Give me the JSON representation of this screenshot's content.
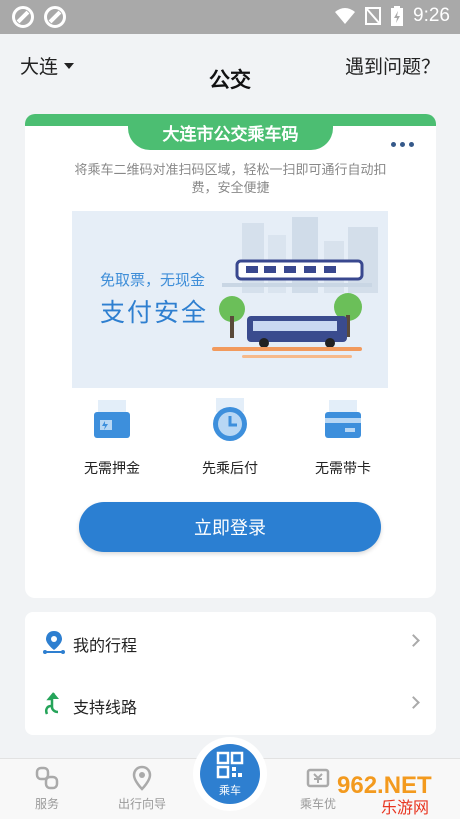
{
  "status_bar": {
    "time": "9:26"
  },
  "header": {
    "city": "大连",
    "title": "公交",
    "help": "遇到问题？"
  },
  "card": {
    "tab_title": "大连市公交乘车码",
    "description": "将乘车二维码对准扫码区域，轻松一扫即可通行自动扣费，安全便捷",
    "banner": {
      "subtitle": "免取票，无现金",
      "headline": "支付安全"
    },
    "features": [
      {
        "label": "无需押金",
        "icon": "wallet-icon"
      },
      {
        "label": "先乘后付",
        "icon": "clock-icon"
      },
      {
        "label": "无需带卡",
        "icon": "card-icon"
      }
    ],
    "login_label": "立即登录"
  },
  "list": [
    {
      "label": "我的行程",
      "icon": "location-pin-icon"
    },
    {
      "label": "支持线路",
      "icon": "route-arrow-icon"
    }
  ],
  "tabbar": [
    {
      "label": "服务",
      "icon": "link-icon"
    },
    {
      "label": "出行向导",
      "icon": "location-icon"
    },
    {
      "label": "乘车",
      "icon": "qr-code-icon"
    },
    {
      "label": "乘车优",
      "icon": "ticket-icon"
    }
  ],
  "watermark": {
    "text": "962.NET",
    "subtext": "乐游网"
  },
  "colors": {
    "green": "#4cbe72",
    "blue": "#2b7fd2",
    "background": "#f1f3f5"
  }
}
